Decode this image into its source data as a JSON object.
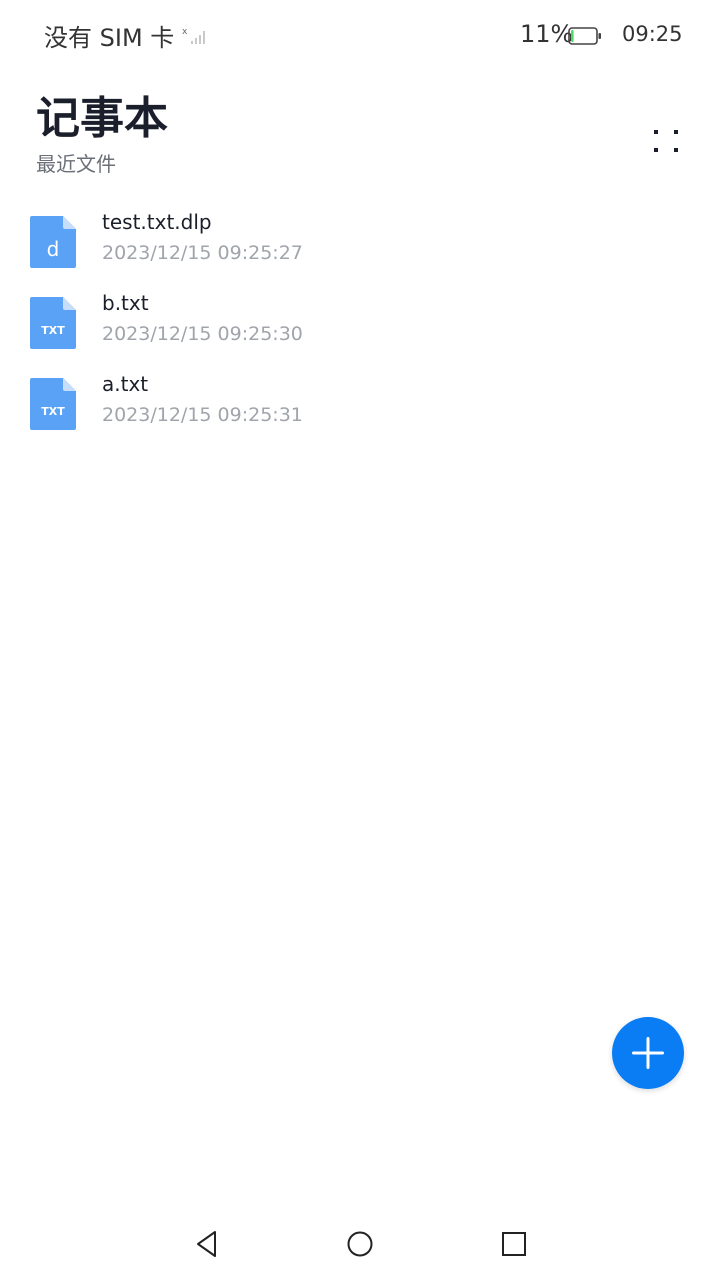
{
  "status_bar": {
    "carrier": "没有 SIM 卡",
    "battery_percent": "11%",
    "battery_level": 0.11,
    "time": "09:25"
  },
  "header": {
    "title": "记事本",
    "subtitle": "最近文件"
  },
  "files": [
    {
      "name": "test.txt.dlp",
      "time": "2023/12/15 09:25:27",
      "icon": "dlp-file-icon",
      "icon_text": "d"
    },
    {
      "name": "b.txt",
      "time": "2023/12/15 09:25:30",
      "icon": "txt-file-icon",
      "icon_text": "TXT"
    },
    {
      "name": "a.txt",
      "time": "2023/12/15 09:25:31",
      "icon": "txt-file-icon",
      "icon_text": "TXT"
    }
  ],
  "colors": {
    "accent": "#0a7df5",
    "file_icon": "#5aa2f5",
    "battery_fill": "#4cd964"
  }
}
